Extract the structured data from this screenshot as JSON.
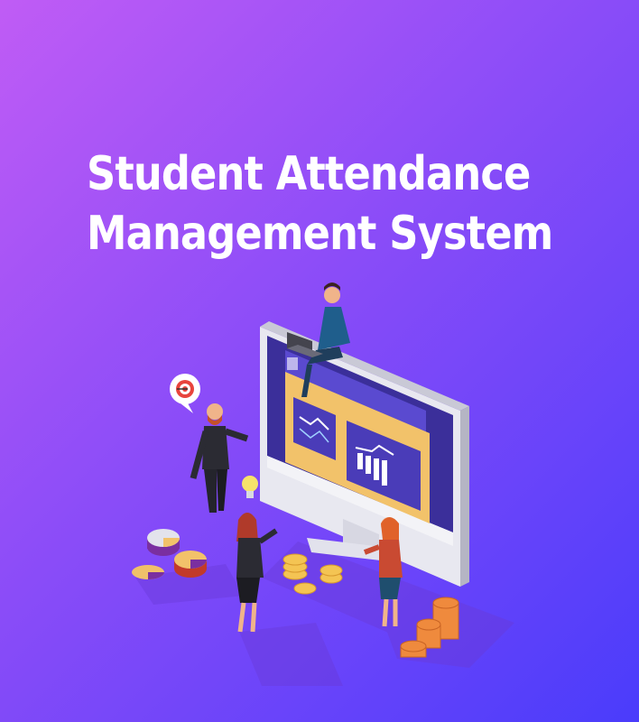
{
  "banner": {
    "title_line1": "Student Attendance",
    "title_line2": "Management System"
  },
  "colors": {
    "background_start": "#c05cf5",
    "background_end": "#4a3cfb",
    "screen_panel": "#f2c26a",
    "coin_gold": "#f4c453",
    "coin_orange": "#ef8a3d"
  },
  "icons": [
    "target-icon",
    "lightbulb-icon",
    "bar-chart-icon",
    "line-chart-icon",
    "pie-chart-icon"
  ]
}
